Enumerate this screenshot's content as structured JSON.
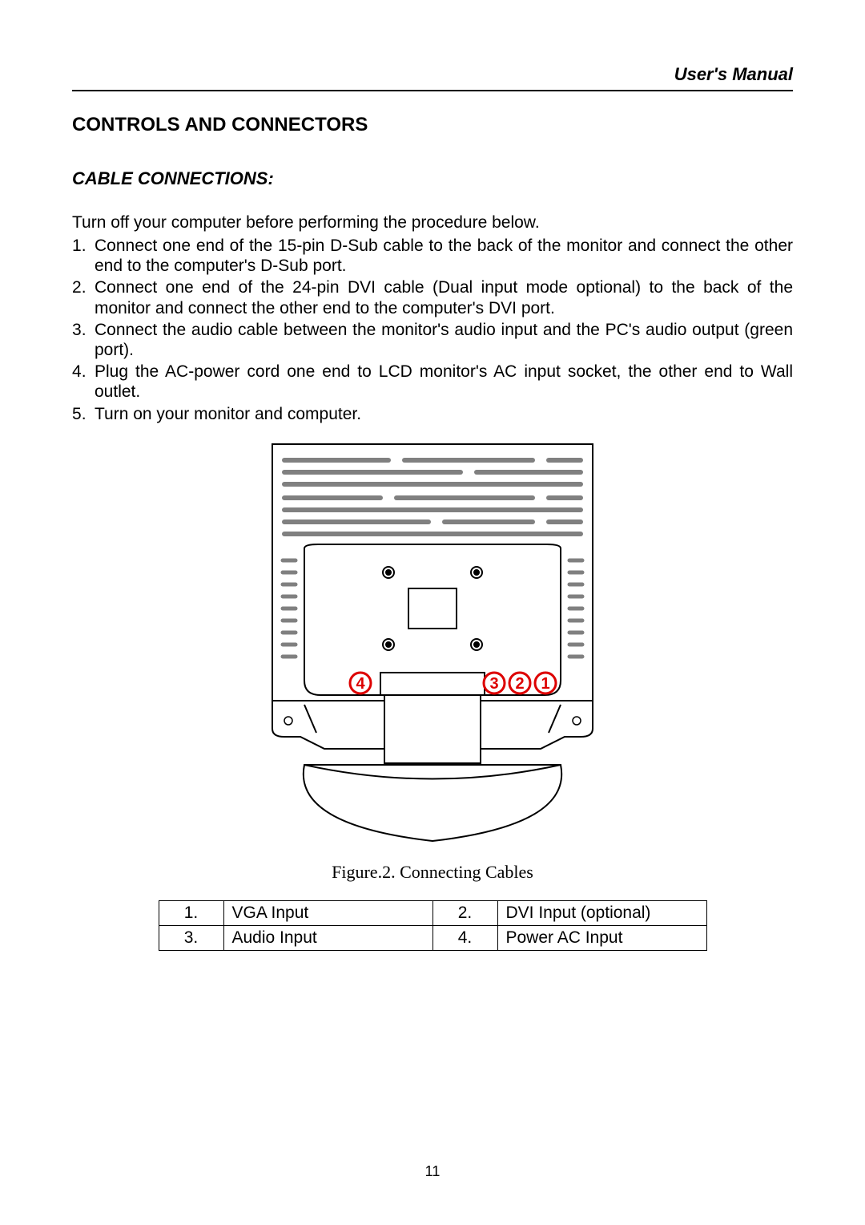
{
  "header": "User's Manual",
  "section_title": "CONTROLS AND CONNECTORS",
  "subsection_title": "CABLE CONNECTIONS:",
  "intro": "Turn off your computer before performing the procedure below.",
  "steps": [
    "Connect one end of the 15-pin D-Sub cable to the back of the monitor and connect the other end to the computer's D-Sub port.",
    "Connect one end of the 24-pin DVI cable (Dual input mode optional) to the back of the monitor and connect the other end to the computer's DVI port.",
    "Connect the audio cable between the monitor's audio input and the PC's audio output (green port).",
    "Plug the AC-power cord one end to LCD monitor's AC input socket, the other end to Wall outlet.",
    "Turn on your monitor and computer."
  ],
  "callouts": {
    "c1": "1",
    "c2": "2",
    "c3": "3",
    "c4": "4"
  },
  "figure_caption": "Figure.2. Connecting Cables",
  "table": {
    "rows": [
      {
        "n1": "1.",
        "l1": "VGA Input",
        "n2": "2.",
        "l2": "DVI Input (optional)"
      },
      {
        "n1": "3.",
        "l1": "Audio Input",
        "n2": "4.",
        "l2": "Power AC Input"
      }
    ]
  },
  "page_number": "11"
}
